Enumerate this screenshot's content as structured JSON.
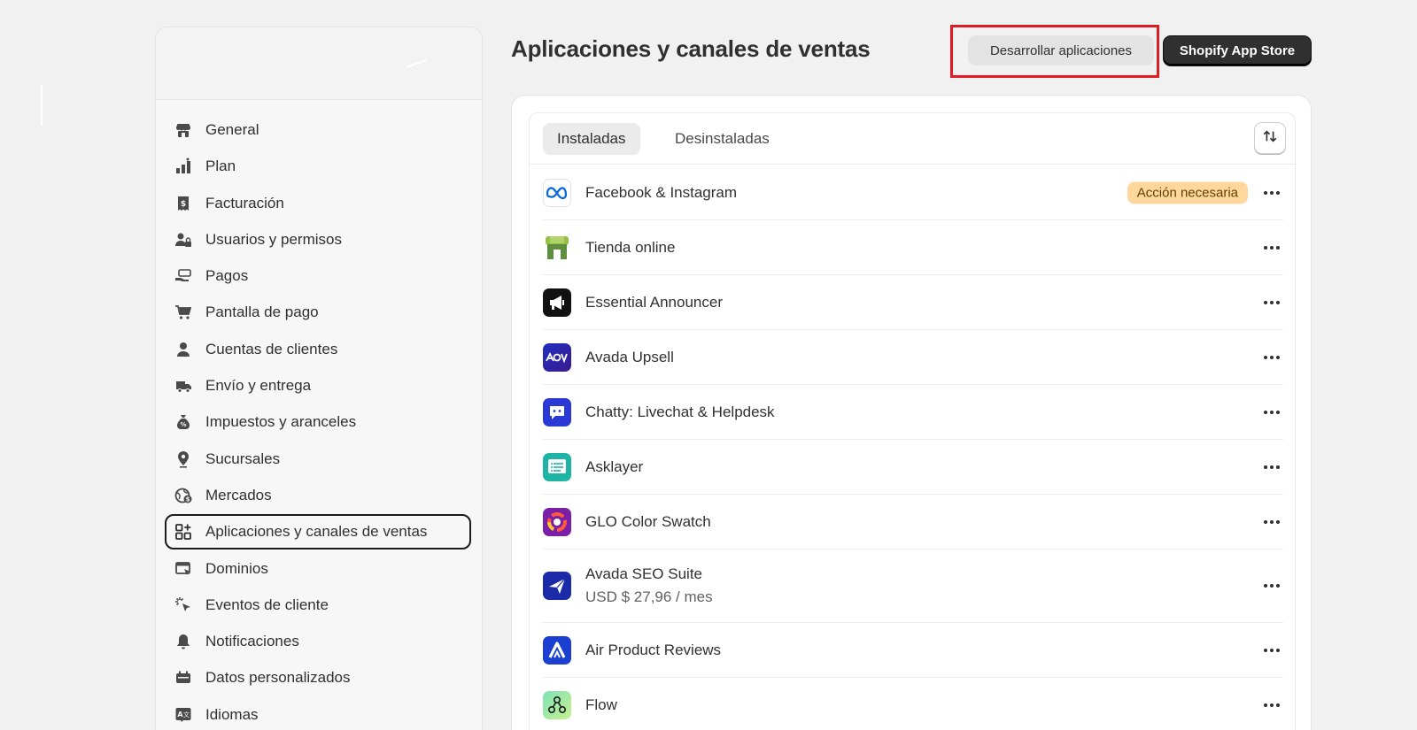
{
  "sidebar": {
    "items": [
      {
        "label": "General",
        "icon": "store-icon"
      },
      {
        "label": "Plan",
        "icon": "plan-icon"
      },
      {
        "label": "Facturación",
        "icon": "receipt-icon"
      },
      {
        "label": "Usuarios y permisos",
        "icon": "users-lock-icon"
      },
      {
        "label": "Pagos",
        "icon": "hand-cash-icon"
      },
      {
        "label": "Pantalla de pago",
        "icon": "cart-icon"
      },
      {
        "label": "Cuentas de clientes",
        "icon": "person-icon"
      },
      {
        "label": "Envío y entrega",
        "icon": "truck-icon"
      },
      {
        "label": "Impuestos y aranceles",
        "icon": "tax-bag-icon"
      },
      {
        "label": "Sucursales",
        "icon": "location-pin-icon"
      },
      {
        "label": "Mercados",
        "icon": "globe-dollar-icon"
      },
      {
        "label": "Aplicaciones y canales de ventas",
        "icon": "apps-add-icon",
        "active": true
      },
      {
        "label": "Dominios",
        "icon": "domain-icon"
      },
      {
        "label": "Eventos de cliente",
        "icon": "cursor-click-icon"
      },
      {
        "label": "Notificaciones",
        "icon": "bell-icon"
      },
      {
        "label": "Datos personalizados",
        "icon": "database-icon"
      },
      {
        "label": "Idiomas",
        "icon": "language-icon"
      }
    ]
  },
  "header": {
    "title": "Aplicaciones y canales de ventas",
    "develop_label": "Desarrollar aplicaciones",
    "store_label": "Shopify App Store"
  },
  "tabs": {
    "installed": "Instaladas",
    "uninstalled": "Desinstaladas"
  },
  "apps": [
    {
      "name": "Facebook & Instagram",
      "badge": "Acción necesaria",
      "icon": "meta-icon"
    },
    {
      "name": "Tienda online",
      "icon": "online-store-icon"
    },
    {
      "name": "Essential Announcer",
      "icon": "megaphone-icon"
    },
    {
      "name": "Avada Upsell",
      "icon": "aov-icon"
    },
    {
      "name": "Chatty: Livechat & Helpdesk",
      "icon": "chat-icon"
    },
    {
      "name": "Asklayer",
      "icon": "faq-list-icon"
    },
    {
      "name": "GLO Color Swatch",
      "icon": "color-swatch-icon"
    },
    {
      "name": "Avada SEO Suite",
      "sub": "USD $ 27,96 / mes",
      "icon": "avada-seo-icon"
    },
    {
      "name": "Air Product Reviews",
      "icon": "air-reviews-icon"
    },
    {
      "name": "Flow",
      "icon": "flow-icon"
    }
  ],
  "colors": {
    "highlight": "#e11b22",
    "badge_bg": "#ffd79d",
    "primary_btn": "#303030"
  }
}
